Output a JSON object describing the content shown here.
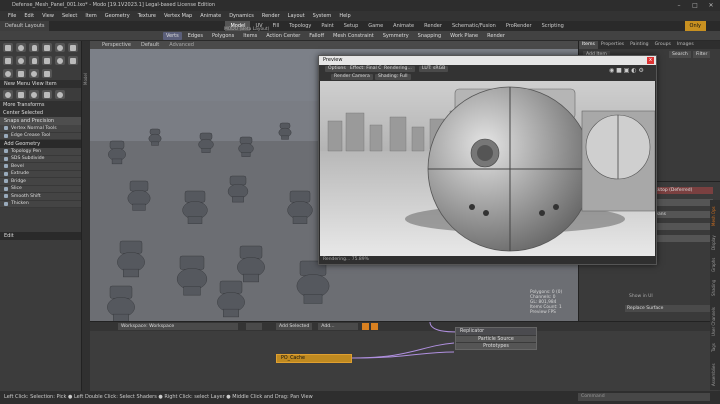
{
  "window": {
    "title": "Defense_Mesh_Panel_001.lxo* - Modo [19.1V2023.1] Legal-based License Edition",
    "minimize": "–",
    "maximize": "□",
    "close": "✕"
  },
  "menubar": [
    "File",
    "Edit",
    "View",
    "Select",
    "Item",
    "Geometry",
    "Texture",
    "Vertex Map",
    "Animate",
    "Dynamics",
    "Render",
    "Layout",
    "System",
    "Help"
  ],
  "layout": {
    "dropdown": "Default Layouts",
    "tabs": [
      "Model",
      "UV",
      "Fill",
      "Topology",
      "Paint",
      "Setup",
      "Game",
      "Animate",
      "Render",
      "Schematic/Fusion",
      "ProRender",
      "Scripting"
    ],
    "active_tab": "Model",
    "center_label": "MODO (Beta Layout)",
    "only": "Only"
  },
  "toolbar": {
    "items": [
      "Verts",
      "Edges",
      "Polygons",
      "Items",
      "Action Center",
      "Falloff",
      "Mesh Constraint",
      "Symmetry",
      "Snapping",
      "Work Plane",
      "Render"
    ],
    "selected": "Verts"
  },
  "left": {
    "view_label": "New Menu View Item",
    "sections": [
      {
        "title": "More Transforms",
        "items": []
      },
      {
        "title": "Center Selected",
        "items": []
      },
      {
        "title": "Snaps and Precision",
        "items": [
          "Vertex Normal Tools",
          "Edge Crease Tool"
        ]
      },
      {
        "title": "Add Geometry",
        "items": [
          "Topology Pen",
          "SDS Subdivide",
          "Bevel",
          "Extrude",
          "Bridge",
          "Slice",
          "Smooth Shift",
          "Thicken"
        ]
      }
    ],
    "edit_label": "Edit"
  },
  "viewport": {
    "view": "Perspective",
    "style": "Default",
    "mode": "Advanced",
    "hud_lines": [
      "Polygons: 0 (0)",
      "Channels: 0",
      "GL: 801,984",
      "Items Count: 1",
      "Preview FPS"
    ],
    "workspace_label": "Workspace: Workspace"
  },
  "node_editor": {
    "add_selected": "Add Selected",
    "add": "Add...",
    "nodes": {
      "replicator": {
        "title": "Replicator",
        "ports": [
          "Particle Source",
          "Prototypes"
        ]
      },
      "cache": {
        "title": "PO_Cache"
      }
    }
  },
  "preview": {
    "title": "Preview",
    "buttons": [
      "Options",
      "Effect: Final C...",
      "Rendering...",
      "LUT: sRGB",
      "Render Camera",
      "Shading: Full"
    ],
    "status": "Rendering... 75.89%",
    "close": "x"
  },
  "right": {
    "tabs": [
      "Items",
      "Properties",
      "Painting",
      "Groups",
      "Images"
    ],
    "filter": "Filter",
    "add_item": "Add Item",
    "search_label": "Search",
    "scene_name": "Defense_Mesh_Panel_001.lxo*",
    "rows": [
      "Mesh",
      "Group Locator",
      "Locator",
      "Texture"
    ],
    "props": [
      {
        "label": "Shader",
        "value": "2017 PC Desktop (Deferred)"
      },
      {
        "label": "Size",
        "value": "Auto"
      },
      {
        "label": "Visibility",
        "value": "Use as Booleans"
      },
      {
        "label": "Material",
        "value": ""
      },
      {
        "label": "Surface",
        "value": ""
      },
      {
        "label": "",
        "value": "Show in UI"
      },
      {
        "label": "",
        "value": "Replace Surface"
      }
    ],
    "vtabs": [
      "Mesh Ops",
      "Display",
      "Graphs",
      "Shading",
      "User Channels",
      "Tags",
      "Assemblies"
    ]
  },
  "status_bar": "Left Click: Selection: Pick ● Left Double Click: Select Shaders ● Right Click: select Layer ● Middle Click and Drag: Pan View",
  "command_placeholder": "Command"
}
